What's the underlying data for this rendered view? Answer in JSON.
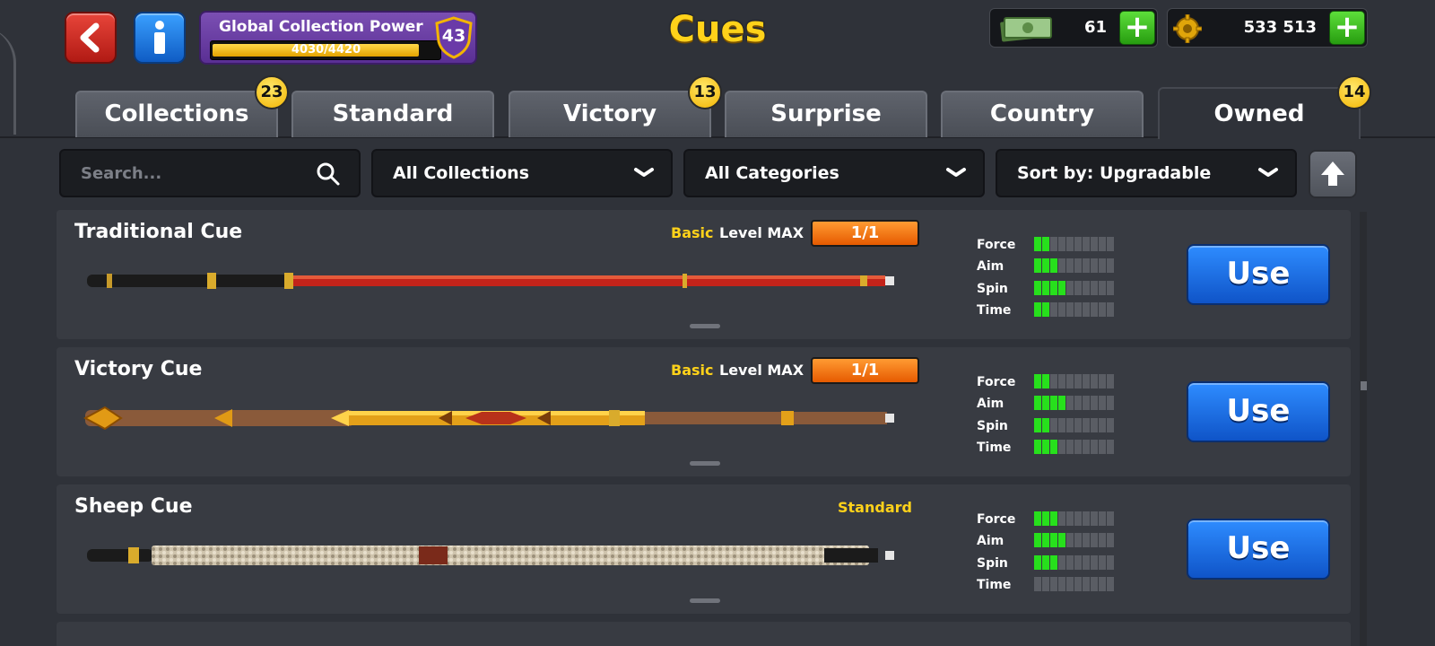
{
  "header": {
    "title": "Cues",
    "global_power": {
      "label": "Global Collection Power",
      "progress_text": "4030/4420",
      "progress": 0.912,
      "level": "43"
    },
    "cash": {
      "amount": "61",
      "icon": "cash-icon"
    },
    "coins": {
      "amount": "533 513",
      "icon": "coin-icon"
    }
  },
  "tabs": [
    {
      "label": "Collections",
      "badge": "23",
      "active": false
    },
    {
      "label": "Standard",
      "badge": "",
      "active": false
    },
    {
      "label": "Victory",
      "badge": "13",
      "active": false
    },
    {
      "label": "Surprise",
      "badge": "",
      "active": false
    },
    {
      "label": "Country",
      "badge": "",
      "active": false
    },
    {
      "label": "Owned",
      "badge": "14",
      "active": true
    }
  ],
  "filters": {
    "search_placeholder": "Search...",
    "collections": "All Collections",
    "categories": "All Categories",
    "sort": "Sort by: Upgradable"
  },
  "cues": [
    {
      "name": "Traditional Cue",
      "rarity": "Basic",
      "level_label": "Level MAX",
      "level_value": "1/1",
      "use_label": "Use",
      "stats": [
        {
          "label": "Force",
          "value": 2
        },
        {
          "label": "Aim",
          "value": 3
        },
        {
          "label": "Spin",
          "value": 4
        },
        {
          "label": "Time",
          "value": 2
        }
      ]
    },
    {
      "name": "Victory Cue",
      "rarity": "Basic",
      "level_label": "Level MAX",
      "level_value": "1/1",
      "use_label": "Use",
      "stats": [
        {
          "label": "Force",
          "value": 2
        },
        {
          "label": "Aim",
          "value": 4
        },
        {
          "label": "Spin",
          "value": 2
        },
        {
          "label": "Time",
          "value": 3
        }
      ]
    },
    {
      "name": "Sheep Cue",
      "rarity": "Standard",
      "level_label": "",
      "level_value": "",
      "use_label": "Use",
      "stats": [
        {
          "label": "Force",
          "value": 3
        },
        {
          "label": "Aim",
          "value": 4
        },
        {
          "label": "Spin",
          "value": 3
        },
        {
          "label": "Time",
          "value": 0
        }
      ]
    }
  ],
  "stat_max": 10,
  "colors": {
    "accent_yellow": "#ffd21a",
    "stat_on": "#27e01c",
    "use_button": "#1f6ee6",
    "level_orange": "#f27a14"
  }
}
